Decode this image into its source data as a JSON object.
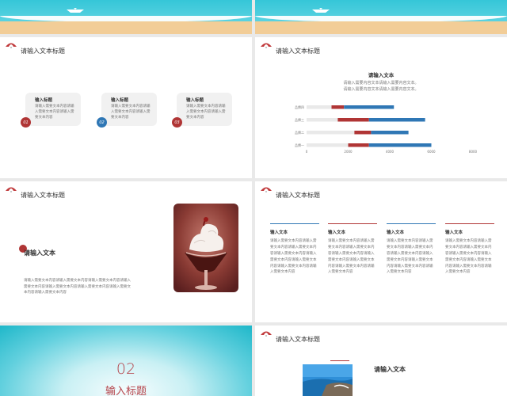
{
  "colors": {
    "accent_red": "#b03535",
    "accent_blue": "#2f77b5",
    "bar_gray": "#e9e9e9",
    "sea": "#35c6d8",
    "sand": "#f2cd97"
  },
  "icons": {
    "slide_header": "umbrella-icon",
    "banner": "paper-boat-icon"
  },
  "slides": {
    "s1": {
      "title": "请输入文本标题",
      "cards": [
        {
          "number": "01",
          "title": "输入标题",
          "text": "请输入需要文本内容请输入需要文本内容请输入需要文本内容"
        },
        {
          "number": "02",
          "title": "输入标题",
          "text": "请输入需要文本内容请输入需要文本内容请输入需要文本内容"
        },
        {
          "number": "03",
          "title": "输入标题",
          "text": "请输入需要文本内容请输入需要文本内容请输入需要文本内容"
        }
      ]
    },
    "s2": {
      "title": "请输入文本标题",
      "chart_title": "请输入文本",
      "chart_subtitle_1": "请输入需要内容文本请输入需要内容文本。",
      "chart_subtitle_2": "请输入需要内容文本请输入需要内容文本。"
    },
    "s3": {
      "title": "请输入文本标题",
      "heading": "请输入文本",
      "body": "请输入需要文本内容请输入需要文本内容请输入需要文本内容请输入需要文本内容请输入需要文本内容请输入需要文本内容请输入需要文本内容请输入需要文本内容"
    },
    "s4": {
      "title": "请输入文本标题",
      "columns": [
        {
          "title": "输入文本",
          "text": "请输入需要文本内容请输入需要文本内容请输入需要文本内容请输入需要文本内容请输入需要文本内容请输入需要文本内容请输入需要文本内容请输入需要文本内容"
        },
        {
          "title": "输入文本",
          "text": "请输入需要文本内容请输入需要文本内容请输入需要文本内容请输入需要文本内容请输入需要文本内容请输入需要文本内容请输入需要文本内容请输入需要文本内容"
        },
        {
          "title": "输入文本",
          "text": "请输入需要文本内容请输入需要文本内容请输入需要文本内容请输入需要文本内容请输入需要文本内容请输入需要文本内容请输入需要文本内容请输入需要文本内容"
        },
        {
          "title": "输入文本",
          "text": "请输入需要文本内容请输入需要文本内容请输入需要文本内容请输入需要文本内容请输入需要文本内容请输入需要文本内容请输入需要文本内容请输入需要文本内容"
        }
      ]
    },
    "s5": {
      "number": "02",
      "title": "输入标题"
    },
    "s6": {
      "title": "请输入文本标题",
      "heading": "请输入文本"
    }
  },
  "chart_data": {
    "type": "bar",
    "orientation": "horizontal",
    "stacked": true,
    "categories": [
      "品牌一",
      "品牌二",
      "品牌三",
      "品牌四"
    ],
    "series": [
      {
        "values": [
          2000,
          2300,
          1500,
          1200
        ]
      },
      {
        "values": [
          1000,
          800,
          1500,
          600
        ]
      },
      {
        "values": [
          3000,
          1800,
          2700,
          2400
        ]
      }
    ],
    "series_colors": [
      "#e9e9e9",
      "#b03535",
      "#2f77b5"
    ],
    "xlim": [
      0,
      8000
    ],
    "xticks": [
      "0",
      "2000",
      "4000",
      "6000",
      "8000"
    ]
  }
}
